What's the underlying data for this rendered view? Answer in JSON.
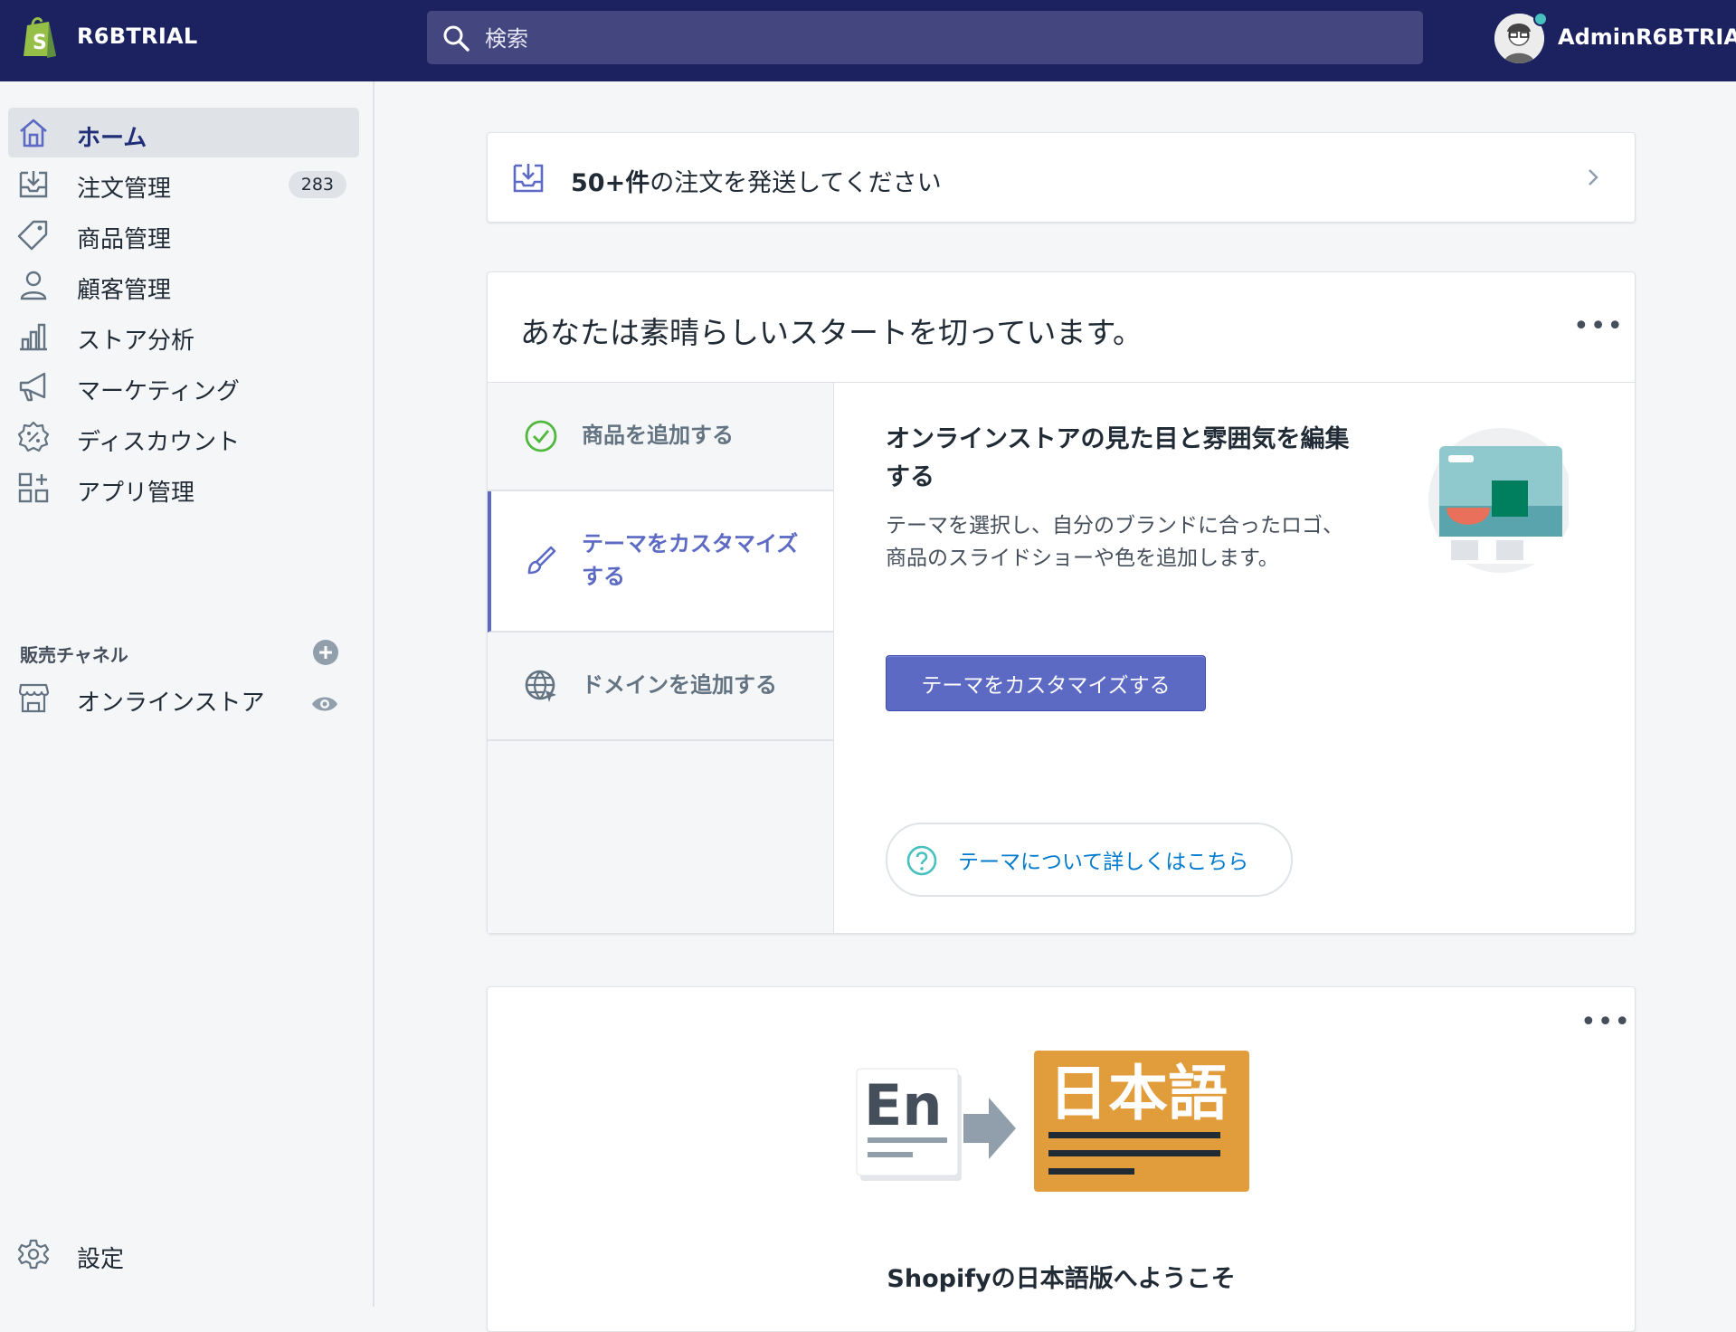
{
  "topbar": {
    "store_name": "R6BTRIAL",
    "search_placeholder": "検索",
    "username": "AdminR6BTRIAL",
    "bg_color": "#1c2260"
  },
  "sidebar": {
    "items": [
      {
        "label": "ホーム",
        "icon": "home-icon",
        "active": true
      },
      {
        "label": "注文管理",
        "icon": "orders-icon",
        "badge": "283"
      },
      {
        "label": "商品管理",
        "icon": "tag-icon"
      },
      {
        "label": "顧客管理",
        "icon": "customer-icon"
      },
      {
        "label": "ストア分析",
        "icon": "analytics-icon"
      },
      {
        "label": "マーケティング",
        "icon": "megaphone-icon"
      },
      {
        "label": "ディスカウント",
        "icon": "discount-icon"
      },
      {
        "label": "アプリ管理",
        "icon": "apps-icon"
      }
    ],
    "sales_channels_title": "販売チャネル",
    "channel": {
      "label": "オンラインストア",
      "icon": "store-icon"
    },
    "settings_label": "設定"
  },
  "notice": {
    "count": "50+件",
    "rest": "の注文を発送してください"
  },
  "setup": {
    "title": "あなたは素晴らしいスタートを切っています。",
    "tabs": [
      {
        "label": "商品を追加する",
        "icon": "check-circle-icon"
      },
      {
        "label": "テーマをカスタマイズする",
        "icon": "paintbrush-icon",
        "selected": true
      },
      {
        "label": "ドメインを追加する",
        "icon": "globe-icon"
      }
    ],
    "panel_title": "オンラインストアの見た目と雰囲気を編集する",
    "panel_desc": "テーマを選択し、自分のブランドに合ったロゴ、商品のスライドショーや色を追加します。",
    "button_label": "テーマをカスタマイズする",
    "learn_more": "テーマについて詳しくはこちら",
    "accent": "#5c6ac4"
  },
  "welcome": {
    "en_text": "En",
    "ja_text": "日本語",
    "title": "Shopifyの日本語版へようこそ"
  }
}
